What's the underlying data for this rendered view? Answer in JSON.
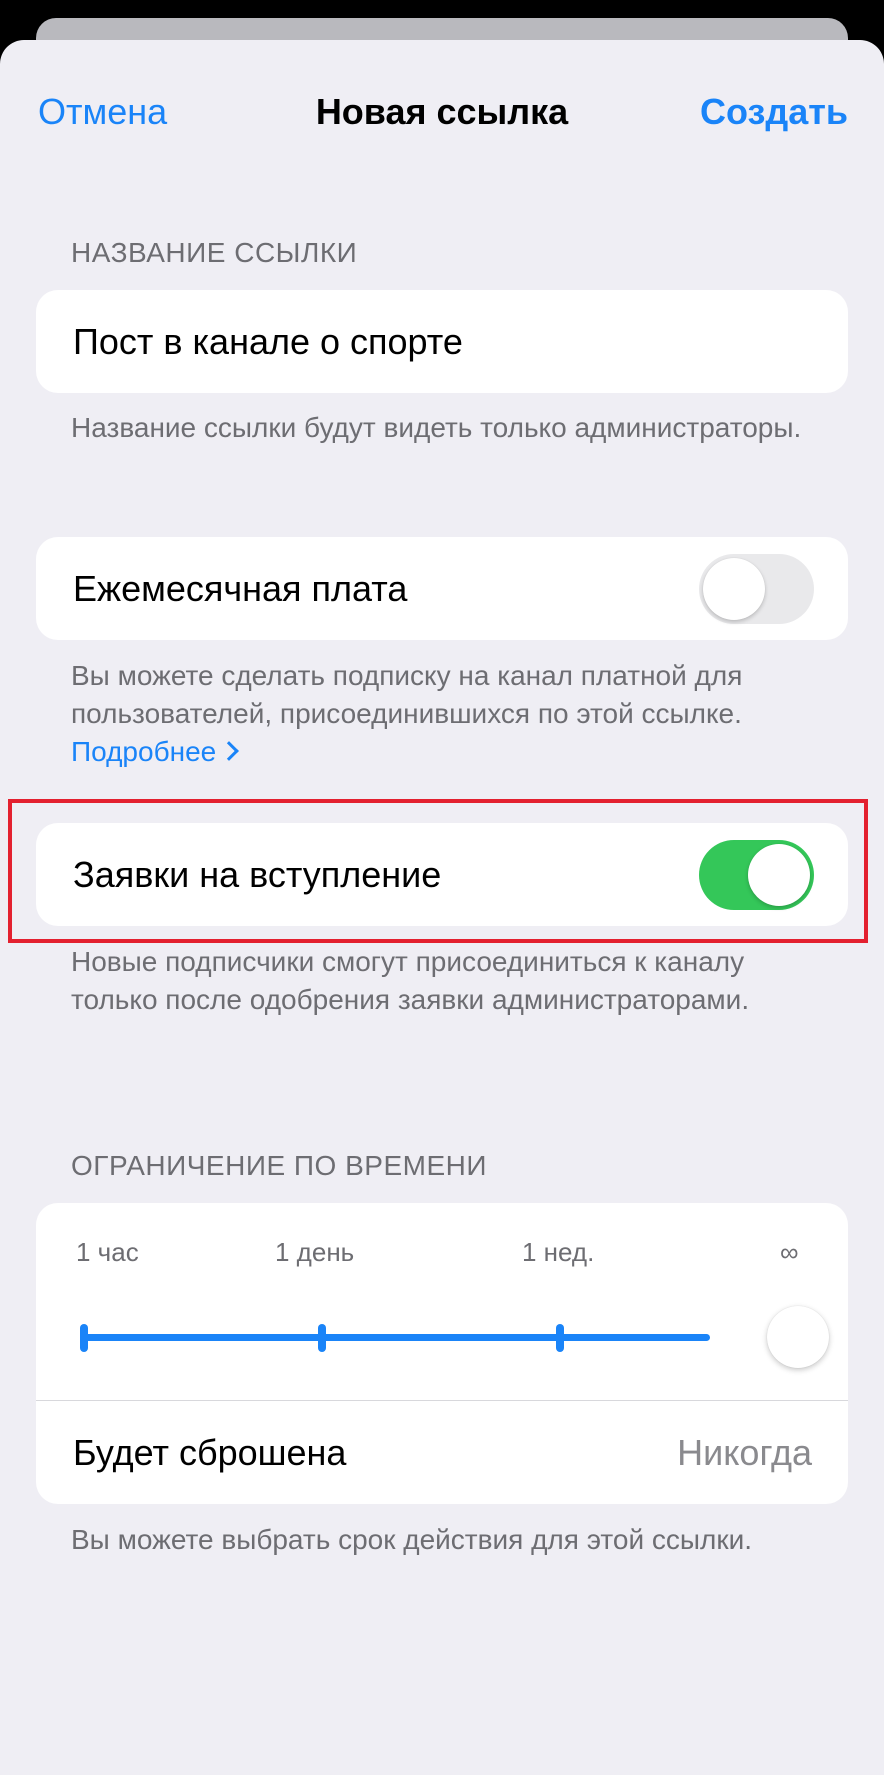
{
  "nav": {
    "cancel_label": "Отмена",
    "title": "Новая ссылка",
    "create_label": "Создать"
  },
  "link_name": {
    "header": "НАЗВАНИЕ ССЫЛКИ",
    "value": "Пост в канале о спорте",
    "footer": "Название ссылки будут видеть только администраторы."
  },
  "monthly_fee": {
    "label": "Ежемесячная плата",
    "enabled": false,
    "footer": "Вы можете сделать подписку на канал платной для пользователей, присоединившихся по этой ссылке.",
    "more_link": "Подробнее"
  },
  "join_requests": {
    "label": "Заявки на вступление",
    "enabled": true,
    "footer": "Новые подписчики смогут присоединиться к каналу только после одобрения заявки администраторами."
  },
  "time_limit": {
    "header": "ОГРАНИЧЕНИЕ ПО ВРЕМЕНИ",
    "ticks": [
      "1 час",
      "1 день",
      "1 нед.",
      "∞"
    ],
    "selected_index": 3,
    "reset_label": "Будет сброшена",
    "reset_value": "Никогда",
    "footer": "Вы можете выбрать срок действия для этой ссылки."
  },
  "colors": {
    "accent": "#1a84f8",
    "toggle_on": "#34c759",
    "highlight": "#e3202f"
  }
}
